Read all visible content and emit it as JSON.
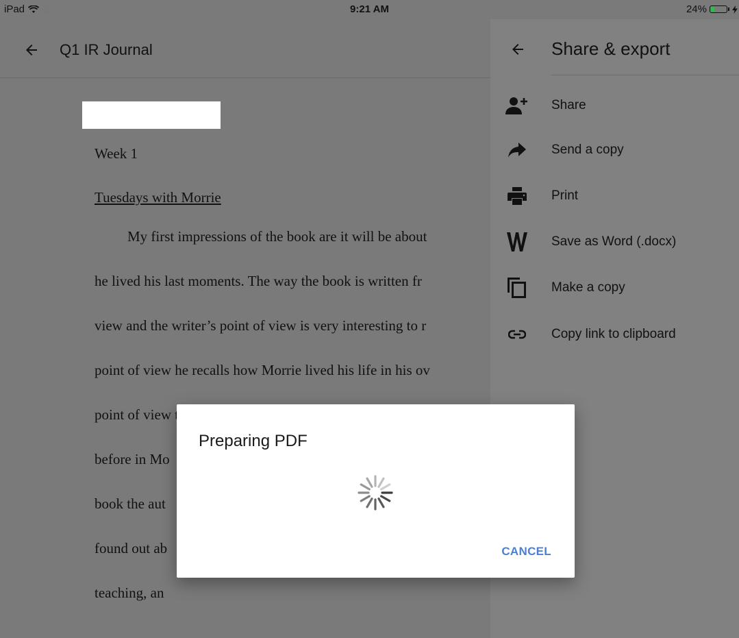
{
  "status_bar": {
    "carrier": "iPad",
    "time": "9:21 AM",
    "battery": "24%",
    "battery_level": 0.24
  },
  "document": {
    "title": "Q1 IR Journal",
    "lines": [
      "Week 1",
      "Tuesdays with Morrie",
      "My first impressions of the book are it will be about",
      "he lived his last moments. The way the book is written fr",
      "view and the writer’s point of view is very interesting to r",
      "point of view he recalls how Morrie lived his life in his ov",
      "point of view the author recalls all the events in Morrie's l",
      "before in Mo",
      "book the aut",
      "found out ab",
      "teaching, an"
    ]
  },
  "share_panel": {
    "title": "Share & export",
    "items": [
      {
        "label": "Share",
        "icon": "add-person-icon"
      },
      {
        "label": "Send a copy",
        "icon": "forward-arrow-icon"
      },
      {
        "label": "Print",
        "icon": "printer-icon"
      },
      {
        "label": "Save as Word (.docx)",
        "icon": "word-icon"
      },
      {
        "label": "Make a copy",
        "icon": "copy-icon"
      },
      {
        "label": "Copy link to clipboard",
        "icon": "link-icon"
      }
    ]
  },
  "dialog": {
    "title": "Preparing PDF",
    "cancel_label": "CANCEL"
  }
}
